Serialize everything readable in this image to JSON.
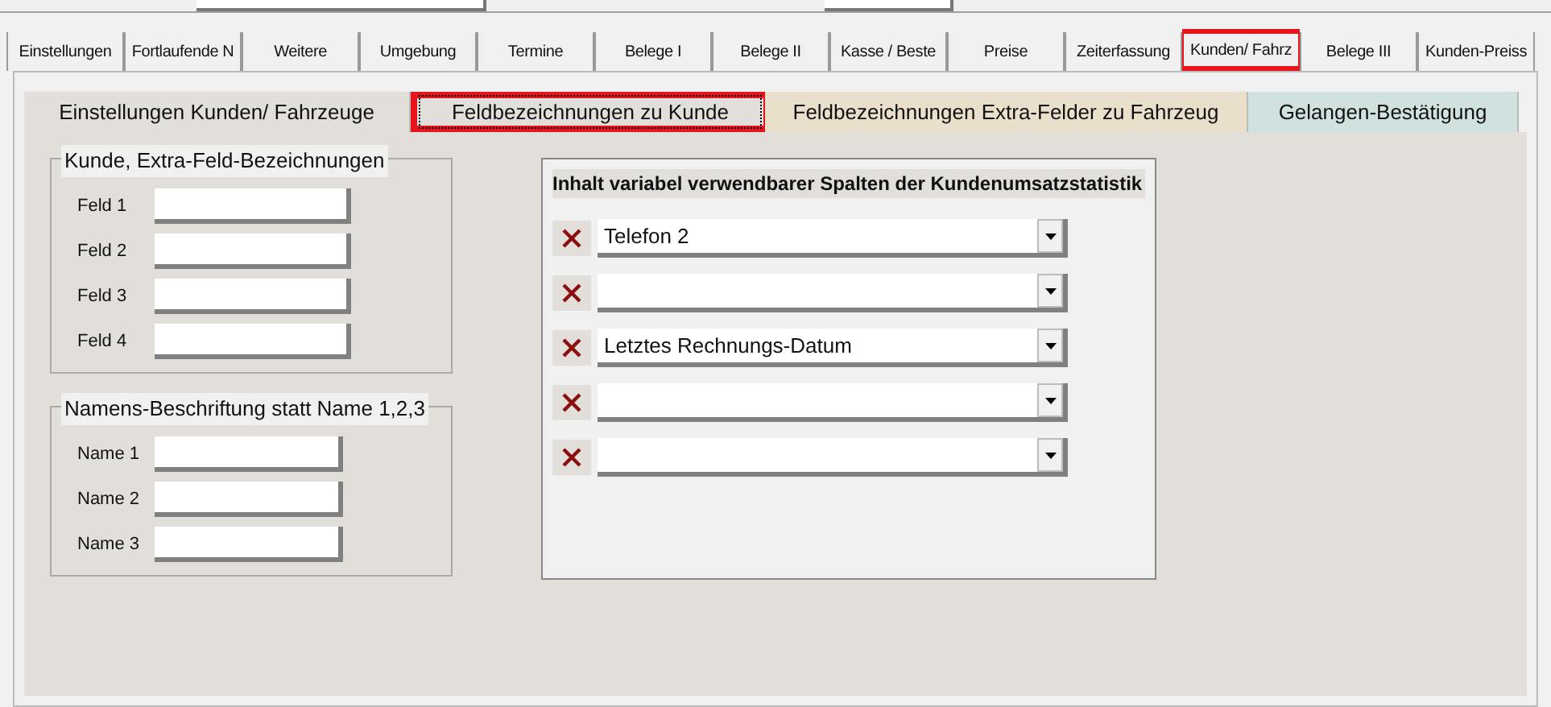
{
  "tabs": [
    {
      "label": "Einstellungen",
      "selected": false,
      "highlighted": false
    },
    {
      "label": "Fortlaufende N",
      "selected": false,
      "highlighted": false
    },
    {
      "label": "Weitere",
      "selected": false,
      "highlighted": false
    },
    {
      "label": "Umgebung",
      "selected": false,
      "highlighted": false
    },
    {
      "label": "Termine",
      "selected": false,
      "highlighted": false
    },
    {
      "label": "Belege I",
      "selected": false,
      "highlighted": false
    },
    {
      "label": "Belege II",
      "selected": false,
      "highlighted": false
    },
    {
      "label": "Kasse / Beste",
      "selected": false,
      "highlighted": false
    },
    {
      "label": "Preise",
      "selected": false,
      "highlighted": false
    },
    {
      "label": "Zeiterfassung",
      "selected": false,
      "highlighted": false
    },
    {
      "label": "Kunden/ Fahrz",
      "selected": true,
      "highlighted": true
    },
    {
      "label": "Belege III",
      "selected": false,
      "highlighted": false
    },
    {
      "label": "Kunden-Preiss",
      "selected": false,
      "highlighted": false
    }
  ],
  "subtabs": [
    {
      "label": "Einstellungen Kunden/ Fahrzeuge",
      "selected": false,
      "highlighted": false,
      "color": "#e2dfdb"
    },
    {
      "label": "Feldbezeichnungen zu Kunde",
      "selected": true,
      "highlighted": true,
      "color": "#e2dfdb"
    },
    {
      "label": "Feldbezeichnungen Extra-Felder zu Fahrzeug",
      "selected": false,
      "highlighted": false,
      "color": "#e9dfca"
    },
    {
      "label": "Gelangen-Bestätigung",
      "selected": false,
      "highlighted": false,
      "color": "#cfe2e0"
    }
  ],
  "groups": [
    {
      "title": "Kunde, Extra-Feld-Bezeichnungen",
      "fields": [
        {
          "label": "Feld 1"
        },
        {
          "label": "Feld 2"
        },
        {
          "label": "Feld 3"
        },
        {
          "label": "Feld 4"
        }
      ]
    },
    {
      "title": "Namens-Beschriftung statt Name 1,2,3",
      "fields": [
        {
          "label": "Name 1"
        },
        {
          "label": "Name 2"
        },
        {
          "label": "Name 3"
        }
      ]
    }
  ],
  "columns_panel": {
    "title": "Inhalt variabel verwendbarer Spalten der Kundenumsatzstatistik",
    "rows": [
      {
        "value": "Telefon 2"
      },
      {
        "value": ""
      },
      {
        "value": "Letztes Rechnungs-Datum"
      },
      {
        "value": ""
      },
      {
        "value": ""
      }
    ]
  }
}
